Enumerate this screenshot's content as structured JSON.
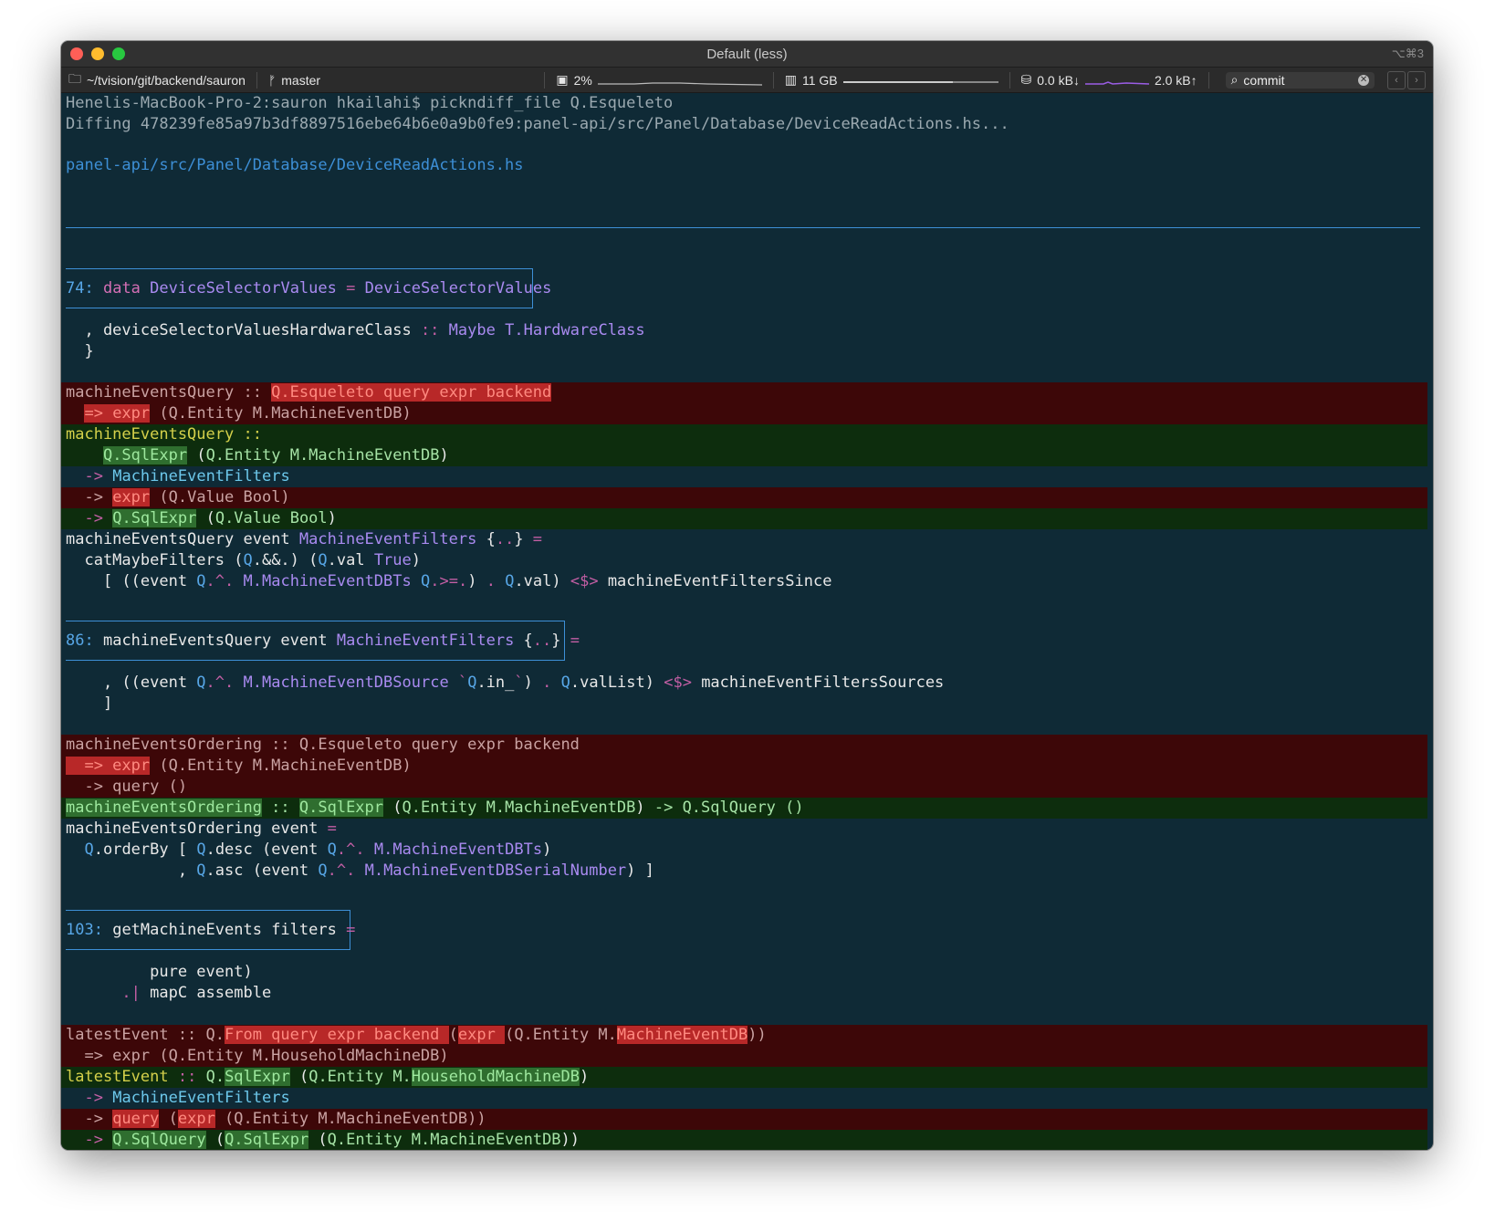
{
  "window": {
    "title": "Default (less)",
    "shortcut": "⌥⌘3"
  },
  "statusbar": {
    "path": "~/tvision/git/backend/sauron",
    "branch": "master",
    "cpu": "2%",
    "memory": "11 GB",
    "net_down": "0.0 kB↓",
    "net_up": "2.0 kB↑",
    "search_value": "commit"
  },
  "colors": {
    "bg": "#0f2a36",
    "deleted_bg": "#3d0708",
    "added_bg": "#0d2d0d",
    "accent": "#3d8fd6"
  },
  "terminal": {
    "prompt_line": "Henelis-MacBook-Pro-2:sauron hkailahi$ pickndiff_file Q.Esqueleto",
    "diffing_line": "Diffing 478239fe85a97b3df8897516ebe64b6e0a9b0fe9:panel-api/src/Panel/Database/DeviceReadActions.hs...",
    "file_path": "panel-api/src/Panel/Database/DeviceReadActions.hs",
    "hunks": [
      {
        "number": "74:",
        "text": "data DeviceSelectorValues = DeviceSelectorValues"
      },
      {
        "number": "86:",
        "text": "machineEventsQuery event MachineEventFilters {..} ="
      },
      {
        "number": "103:",
        "text": "getMachineEvents filters ="
      }
    ]
  }
}
